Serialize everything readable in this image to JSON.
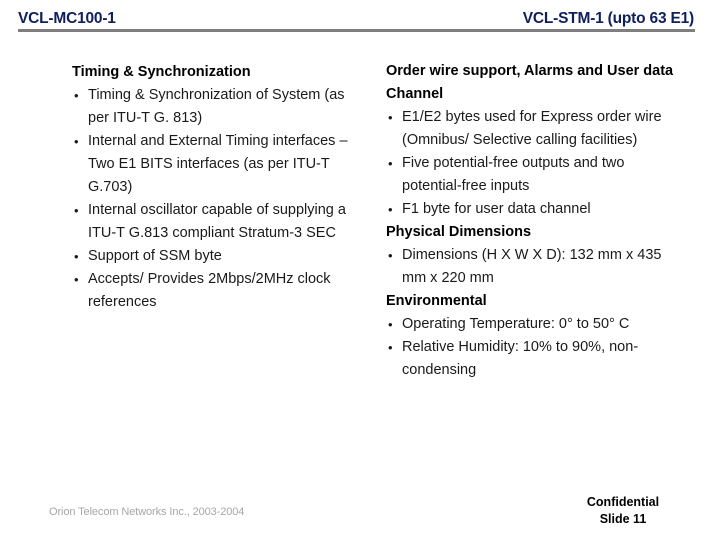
{
  "header": {
    "left_title": "VCL-MC100-1",
    "right_title": "VCL-STM-1 (upto 63 E1)",
    "title_color": "#0f1f5c",
    "rule_color": "#7f7f7f"
  },
  "left_column": {
    "sections": [
      {
        "heading": "Timing & Synchronization",
        "bullets": [
          "Timing & Synchronization of System (as per ITU-T G. 813)",
          "Internal and External Timing interfaces – Two E1 BITS interfaces (as per ITU-T G.703)",
          "Internal oscillator capable of supplying a ITU-T G.813 compliant Stratum-3 SEC",
          "Support of SSM byte",
          "Accepts/ Provides 2Mbps/2MHz clock references"
        ]
      }
    ]
  },
  "right_column": {
    "sections": [
      {
        "heading": "Order wire support, Alarms and User data Channel",
        "bullets": [
          "E1/E2 bytes used for Express order wire (Omnibus/ Selective calling facilities)",
          "Five potential-free outputs and two potential-free inputs",
          "F1 byte for user data channel"
        ]
      },
      {
        "heading": "Physical Dimensions",
        "bullets": [
          "Dimensions (H X W X D): 132 mm x 435 mm x 220 mm"
        ]
      },
      {
        "heading": "Environmental",
        "bullets": [
          "Operating Temperature: 0° to 50° C",
          "Relative Humidity: 10% to 90%, non-condensing"
        ]
      }
    ]
  },
  "bullet_glyph": "•",
  "footer": {
    "copyright": "Orion Telecom Networks Inc., 2003-2004",
    "confidential": "Confidential",
    "slide_label": "Slide 11"
  }
}
